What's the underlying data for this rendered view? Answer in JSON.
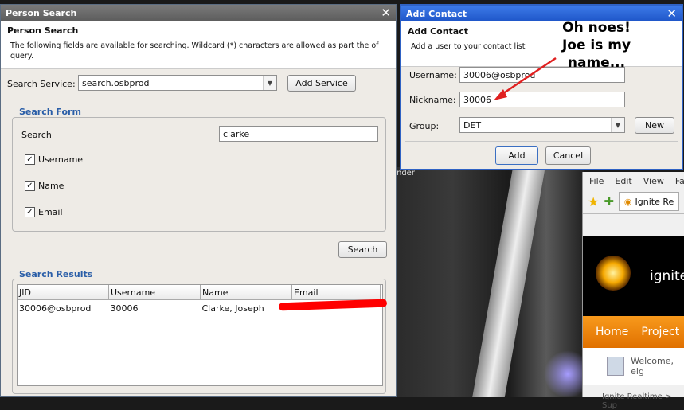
{
  "background": {
    "photo_label": "nder",
    "browser": {
      "menu": [
        "File",
        "Edit",
        "View",
        "Fav"
      ],
      "tab_label": "Ignite Re",
      "logo_text": "ignite",
      "nav": [
        "Home",
        "Project"
      ],
      "welcome": "Welcome, elg",
      "breadcrumb": "Ignite Realtime > Sup"
    }
  },
  "person_search": {
    "title": "Person Search",
    "header_title": "Person Search",
    "header_desc": "The following fields are available for searching. Wildcard (*) characters are allowed as part the of query.",
    "service_label": "Search Service:",
    "service_value": "search.osbprod",
    "add_service": "Add Service",
    "form_title": "Search Form",
    "search_label": "Search",
    "search_value": "clarke",
    "checkboxes": [
      {
        "label": "Username",
        "checked": true
      },
      {
        "label": "Name",
        "checked": true
      },
      {
        "label": "Email",
        "checked": true
      }
    ],
    "search_button": "Search",
    "results_title": "Search Results",
    "columns": [
      "JID",
      "Username",
      "Name",
      "Email"
    ],
    "rows": [
      {
        "jid": "30006@osbprod",
        "username": "30006",
        "name": "Clarke, Joseph",
        "email": ""
      }
    ]
  },
  "add_contact": {
    "title": "Add Contact",
    "header_title": "Add Contact",
    "header_desc": "Add a user to your contact list",
    "username_label": "Username:",
    "username_value": "30006@osbprod",
    "nickname_label": "Nickname:",
    "nickname_value": "30006",
    "group_label": "Group:",
    "group_value": "DET",
    "new_button": "New",
    "add_button": "Add",
    "cancel_button": "Cancel"
  },
  "annotation": {
    "text_line1": "Oh noes!",
    "text_line2": "Joe is my",
    "text_line3": "name...",
    "color": "#e02020"
  }
}
